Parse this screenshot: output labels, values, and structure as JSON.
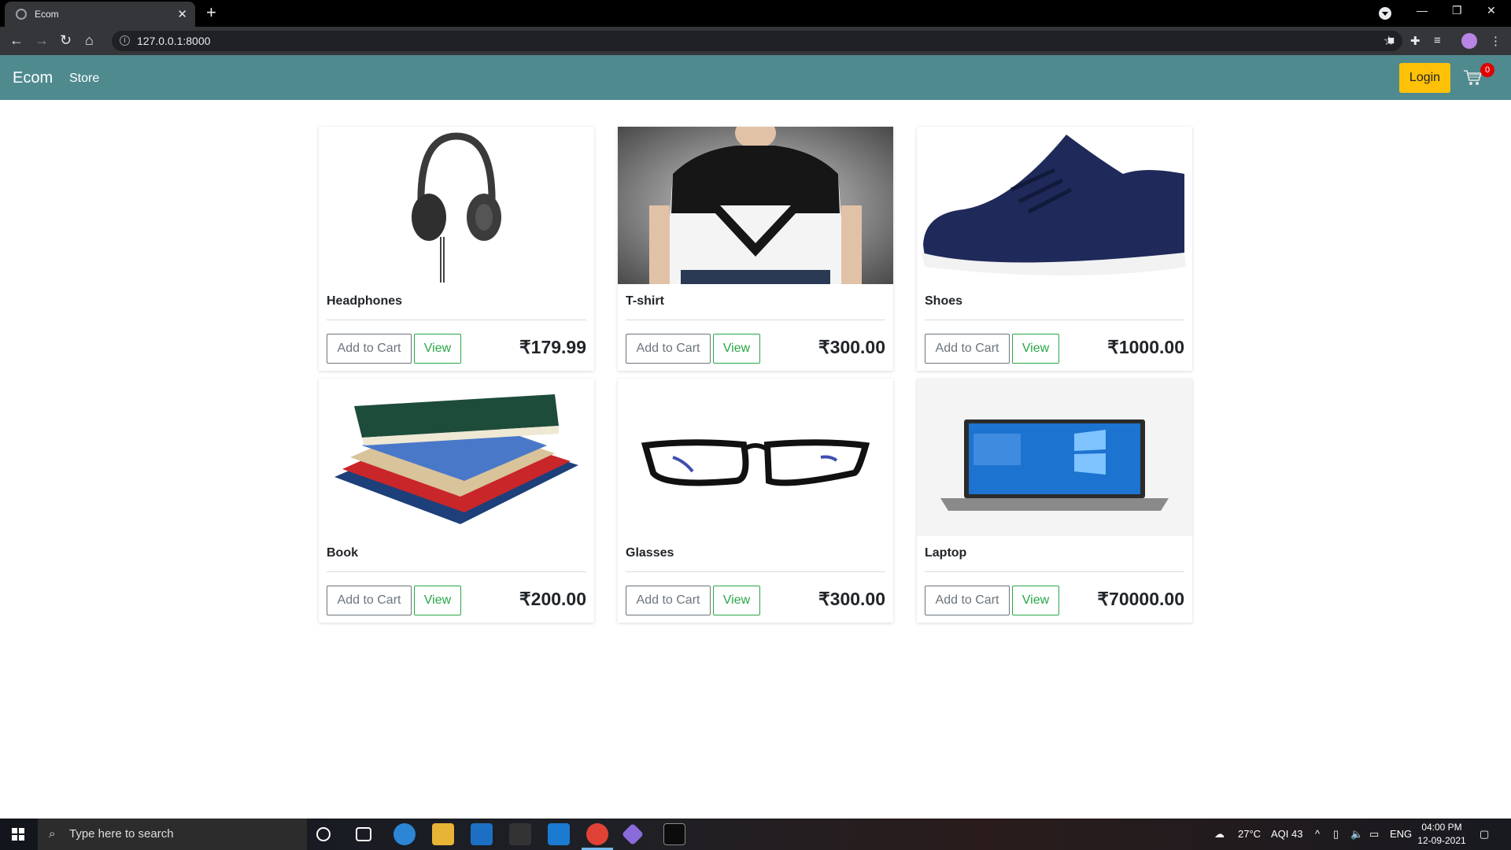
{
  "browser": {
    "tab_title": "Ecom",
    "tab_close": "✕",
    "new_tab": "+",
    "url": "127.0.0.1:8000"
  },
  "site": {
    "brand": "Ecom",
    "nav_store": "Store",
    "login_label": "Login",
    "cart_count": "0",
    "accent_color": "#4f8a8f",
    "login_color": "#ffc107"
  },
  "products": [
    {
      "title": "Headphones",
      "add_label": "Add to Cart",
      "view_label": "View",
      "price": "₹179.99"
    },
    {
      "title": "T-shirt",
      "add_label": "Add to Cart",
      "view_label": "View",
      "price": "₹300.00"
    },
    {
      "title": "Shoes",
      "add_label": "Add to Cart",
      "view_label": "View",
      "price": "₹1000.00"
    },
    {
      "title": "Book",
      "add_label": "Add to Cart",
      "view_label": "View",
      "price": "₹200.00"
    },
    {
      "title": "Glasses",
      "add_label": "Add to Cart",
      "view_label": "View",
      "price": "₹300.00"
    },
    {
      "title": "Laptop",
      "add_label": "Add to Cart",
      "view_label": "View",
      "price": "₹70000.00"
    }
  ],
  "taskbar": {
    "search_placeholder": "Type here to search",
    "weather": "27°C",
    "aqi": "AQI 43",
    "lang": "ENG",
    "time": "04:00 PM",
    "date": "12-09-2021"
  }
}
